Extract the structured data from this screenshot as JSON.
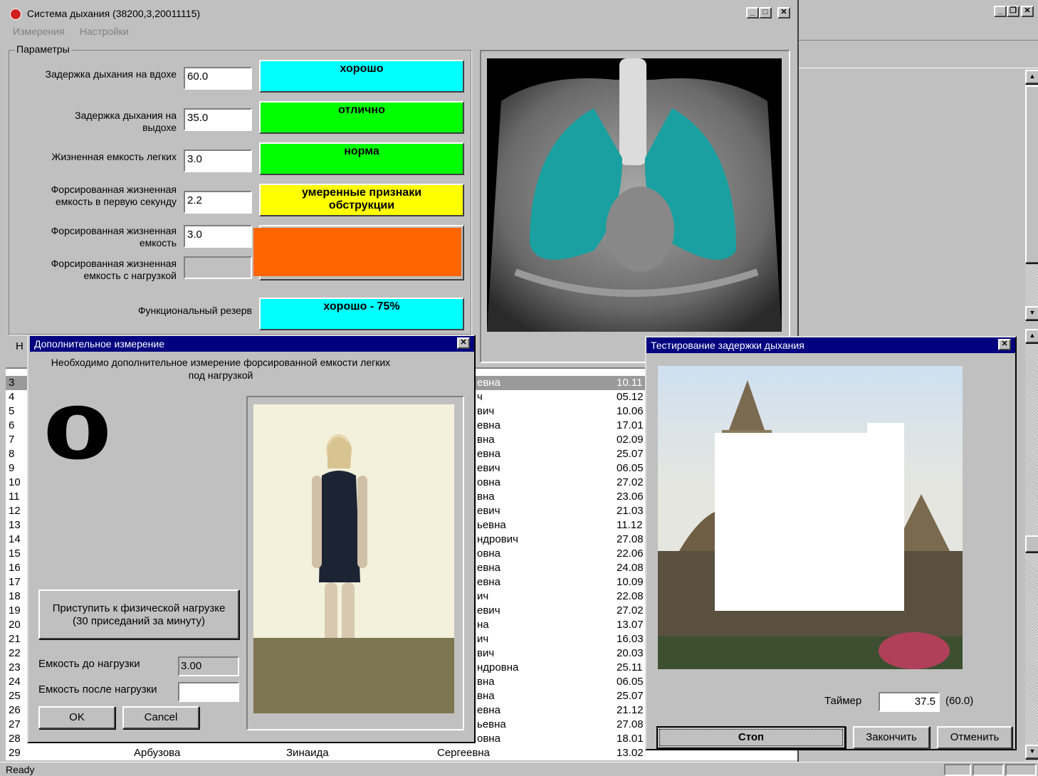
{
  "main_window": {
    "title": "Система дыхания (38200,3,20011115)",
    "menu": [
      "Измерения",
      "Настройки"
    ]
  },
  "params": {
    "group_title": "Параметры",
    "items": [
      {
        "label": "Задержка дыхания на вдохе",
        "value": "60.0",
        "status": "хорошо",
        "status_color": "#00ffff"
      },
      {
        "label": "Задержка дыхания на выдохе",
        "value": "35.0",
        "status": "отлично",
        "status_color": "#00ff00"
      },
      {
        "label": "Жизненная емкость легких",
        "value": "3.0",
        "status": "норма",
        "status_color": "#00ff00"
      },
      {
        "label": "Форсированная жизненная емкость в первую секунду",
        "value": "2.2",
        "status": "умеренные признаки обструкции",
        "status_color": "#ffff00"
      },
      {
        "label": "Форсированная жизненная емкость",
        "value": "3.0",
        "status": "",
        "status_color": "#ff6600"
      },
      {
        "label": "Форсированная жизненная емкость с нагрузкой",
        "value": "",
        "status": "",
        "status_color": "#c0c0c0"
      }
    ],
    "reserve_label": "Функциональный резерв",
    "reserve_status": "хорошо - 75%",
    "reserve_color": "#00ffff"
  },
  "extra_dialog": {
    "title": "Дополнительное измерение",
    "message": "Необходимо дополнительное измерение форсированной емкости легких под нагрузкой",
    "counter": "0",
    "start_button": "Приступить к физической нагрузке (30 приседаний за минуту)",
    "before_label": "Емкость до нагрузки",
    "before_value": "3.00",
    "after_label": "Емкость после нагрузки",
    "after_value": "",
    "ok": "OK",
    "cancel": "Cancel"
  },
  "test_dialog": {
    "title": "Тестирование задержки дыхания",
    "timer_label": "Таймер",
    "timer_value": "37.5",
    "timer_max": "(60.0)",
    "stop": "Стоп",
    "finish": "Закончить",
    "cancel": "Отменить"
  },
  "list": {
    "partial_label": "Н",
    "numbers": [
      "3",
      "4",
      "5",
      "6",
      "7",
      "8",
      "9",
      "10",
      "11",
      "12",
      "13",
      "14",
      "15",
      "16",
      "17",
      "18",
      "19",
      "20",
      "21",
      "22",
      "23",
      "24",
      "25",
      "26",
      "27",
      "28",
      "29"
    ],
    "patronymic_frag": [
      "евна",
      "ч",
      "вич",
      "евна",
      "вна",
      "евна",
      "евич",
      "овна",
      "вна",
      "евич",
      "ьевна",
      "ндрович",
      "овна",
      "евна",
      "евна",
      "ич",
      "евич",
      "на",
      "ич",
      "вич",
      "ндровна",
      "вна",
      "вна",
      "евна",
      "ьевна",
      "овна"
    ],
    "dates": [
      "10.11",
      "05.12",
      "10.06",
      "17.01",
      "02.09",
      "25.07",
      "06.05",
      "27.02",
      "23.06",
      "21.03",
      "11.12",
      "27.08",
      "22.06",
      "24.08",
      "10.09",
      "22.08",
      "27.02",
      "13.07",
      "16.03",
      "20.03",
      "25.11",
      "06.05",
      "25.07",
      "21.12",
      "27.08",
      "18.01",
      "13.02"
    ],
    "last_row": {
      "surname": "Арбузова",
      "name": "Зинаида",
      "patronymic": "Сергеевна"
    }
  },
  "statusbar": {
    "text": "Ready"
  }
}
